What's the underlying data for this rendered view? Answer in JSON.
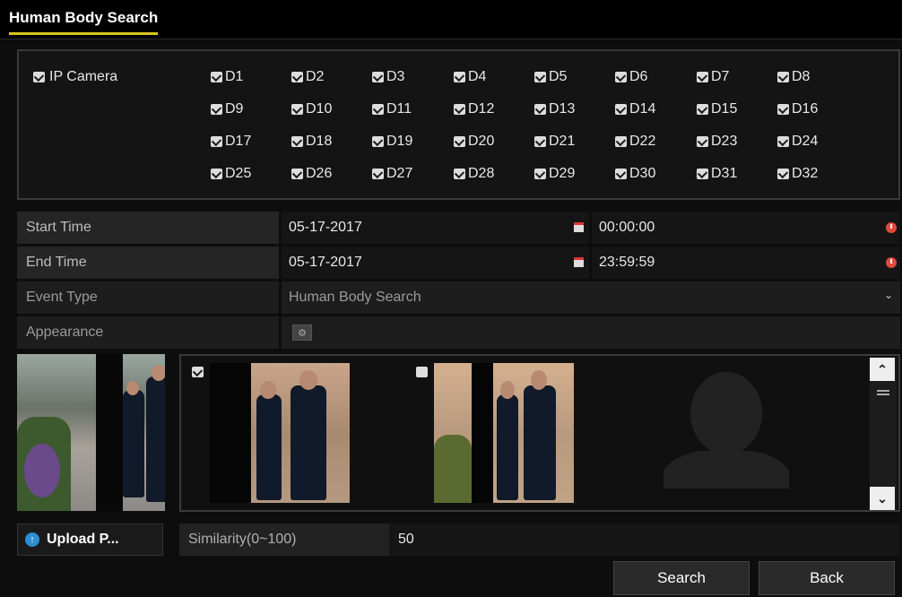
{
  "header": {
    "title": "Human Body Search"
  },
  "camera": {
    "master_label": "IP Camera",
    "channels": [
      "D1",
      "D2",
      "D3",
      "D4",
      "D5",
      "D6",
      "D7",
      "D8",
      "D9",
      "D10",
      "D11",
      "D12",
      "D13",
      "D14",
      "D15",
      "D16",
      "D17",
      "D18",
      "D19",
      "D20",
      "D21",
      "D22",
      "D23",
      "D24",
      "D25",
      "D26",
      "D27",
      "D28",
      "D29",
      "D30",
      "D31",
      "D32"
    ]
  },
  "form": {
    "start_time": {
      "label": "Start Time",
      "date": "05-17-2017",
      "time": "00:00:00"
    },
    "end_time": {
      "label": "End Time",
      "date": "05-17-2017",
      "time": "23:59:59"
    },
    "event_type": {
      "label": "Event Type",
      "value": "Human Body Search"
    },
    "appearance": {
      "label": "Appearance"
    }
  },
  "results": [
    {
      "checked": true
    },
    {
      "checked": false
    },
    {
      "placeholder": true
    }
  ],
  "bottom": {
    "upload_label": "Upload P...",
    "similarity_label": "Similarity(0~100)",
    "similarity_value": "50"
  },
  "actions": {
    "search": "Search",
    "back": "Back"
  },
  "colors": {
    "accent": "#d8c51a",
    "clock": "#e04a3a",
    "upload": "#2a8fd4"
  }
}
